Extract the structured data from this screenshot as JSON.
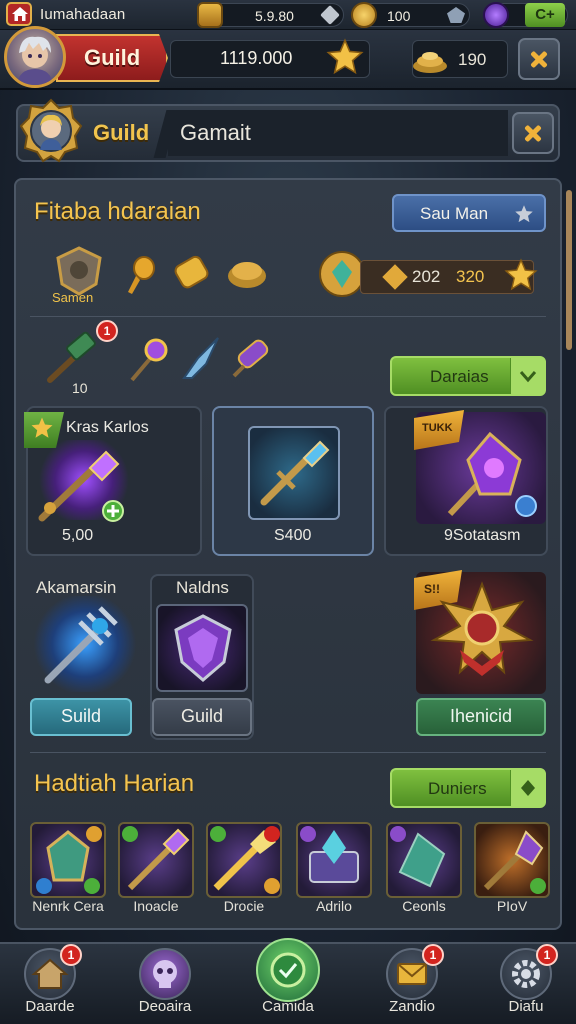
{
  "topbar": {
    "player_name": "Iumahadaan",
    "resources": [
      {
        "icon": "gold-cube-icon",
        "value": "5.9.80"
      },
      {
        "icon": "gold-coin-icon",
        "value": "100"
      },
      {
        "icon": "gem-icon",
        "value": ""
      }
    ],
    "add_label": "C+"
  },
  "header": {
    "guild_tag": "Guild",
    "power_value": "1119.000",
    "honor_value": "190"
  },
  "guild_bar": {
    "label": "Guild",
    "input_value": "Gamait"
  },
  "section1": {
    "title": "Fitaba hdaraian",
    "button": "Sau Man",
    "emblem_label": "Samen",
    "counter_a": "202",
    "counter_b": "320",
    "tool_count": "10",
    "tool_badge": "1",
    "green_button": "Daraias"
  },
  "cards": [
    {
      "title": "Kras Karlos",
      "value": "5,00"
    },
    {
      "title": "",
      "value": "S400"
    },
    {
      "title": "",
      "tag": "TUKK",
      "value": "9Sotatasm"
    },
    {
      "title": "Akamarsin",
      "button": "Suild"
    },
    {
      "title": "Naldns",
      "button": "Guild"
    },
    {
      "title": "",
      "tag": "S!!",
      "button": "Ihenicid"
    }
  ],
  "section2": {
    "title": "Hadtiah Harian",
    "button": "Duniers"
  },
  "rewards": [
    {
      "label": "Nenrk Cera"
    },
    {
      "label": "Inoacle"
    },
    {
      "label": "Drocie"
    },
    {
      "label": "Adrilo"
    },
    {
      "label": "Ceonls"
    },
    {
      "label": "PIoV"
    }
  ],
  "nav": [
    {
      "label": "Daarde",
      "badge": "1"
    },
    {
      "label": "Deoaira",
      "badge": ""
    },
    {
      "label": "Camida",
      "badge": ""
    },
    {
      "label": "Zandio",
      "badge": "1"
    },
    {
      "label": "Diafu",
      "badge": "1"
    }
  ],
  "colors": {
    "gold_title": "#f4c44f",
    "guild_red": "#c2332f",
    "button_green": "#7fc03f",
    "button_blue": "#4a6fa8",
    "badge_red": "#d2241f"
  }
}
